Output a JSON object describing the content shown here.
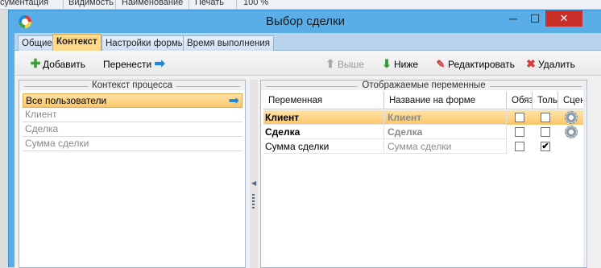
{
  "background_toolbar": {
    "items": [
      "сументация",
      "Видимость",
      "Наименование",
      "Печать",
      "100 %"
    ]
  },
  "window": {
    "title": "Выбор сделки",
    "min_glyph": "─",
    "max_glyph": "☐",
    "close_glyph": "✕"
  },
  "tabs": [
    {
      "label": "Общие"
    },
    {
      "label": "Контекст",
      "active": true
    },
    {
      "label": "Настройки формы"
    },
    {
      "label": "Время выполнения"
    }
  ],
  "toolbar": {
    "add_label": "Добавить",
    "move_label": "Перенести",
    "up_label": "Выше",
    "down_label": "Ниже",
    "edit_label": "Редактировать",
    "delete_label": "Удалить"
  },
  "icons": {
    "add": "plus-icon",
    "move": "arrow-right-icon",
    "up": "arrow-up-icon",
    "down": "arrow-down-icon",
    "edit": "pencil-icon",
    "delete": "x-icon",
    "script": "gear-icon"
  },
  "left_panel": {
    "title": "Контекст процесса",
    "rows": [
      {
        "label": "Все пользователи",
        "selected": true
      },
      {
        "label": "Клиент"
      },
      {
        "label": "Сделка"
      },
      {
        "label": "Сумма сделки"
      }
    ]
  },
  "right_panel": {
    "title": "Отображаемые переменные",
    "columns": {
      "variable": "Переменная",
      "form_name": "Название на форме",
      "required": "Обяз",
      "readonly": "Толь",
      "script": "Сцен"
    },
    "rows": [
      {
        "variable": "Клиент",
        "form_name": "Клиент",
        "required": false,
        "readonly": false,
        "script": true,
        "selected": true,
        "bold": true
      },
      {
        "variable": "Сделка",
        "form_name": "Сделка",
        "required": false,
        "readonly": false,
        "script": true,
        "bold": true
      },
      {
        "variable": "Сумма сделки",
        "form_name": "Сумма сделки",
        "required": false,
        "readonly": true,
        "script": false
      }
    ]
  },
  "colors": {
    "window_frame": "#5aaee8",
    "close_button": "#c9302c",
    "selection": "#f9c76a",
    "tab_active": "#ffd98a",
    "arrow": "#1f86d6"
  },
  "check_glyph": "✔"
}
